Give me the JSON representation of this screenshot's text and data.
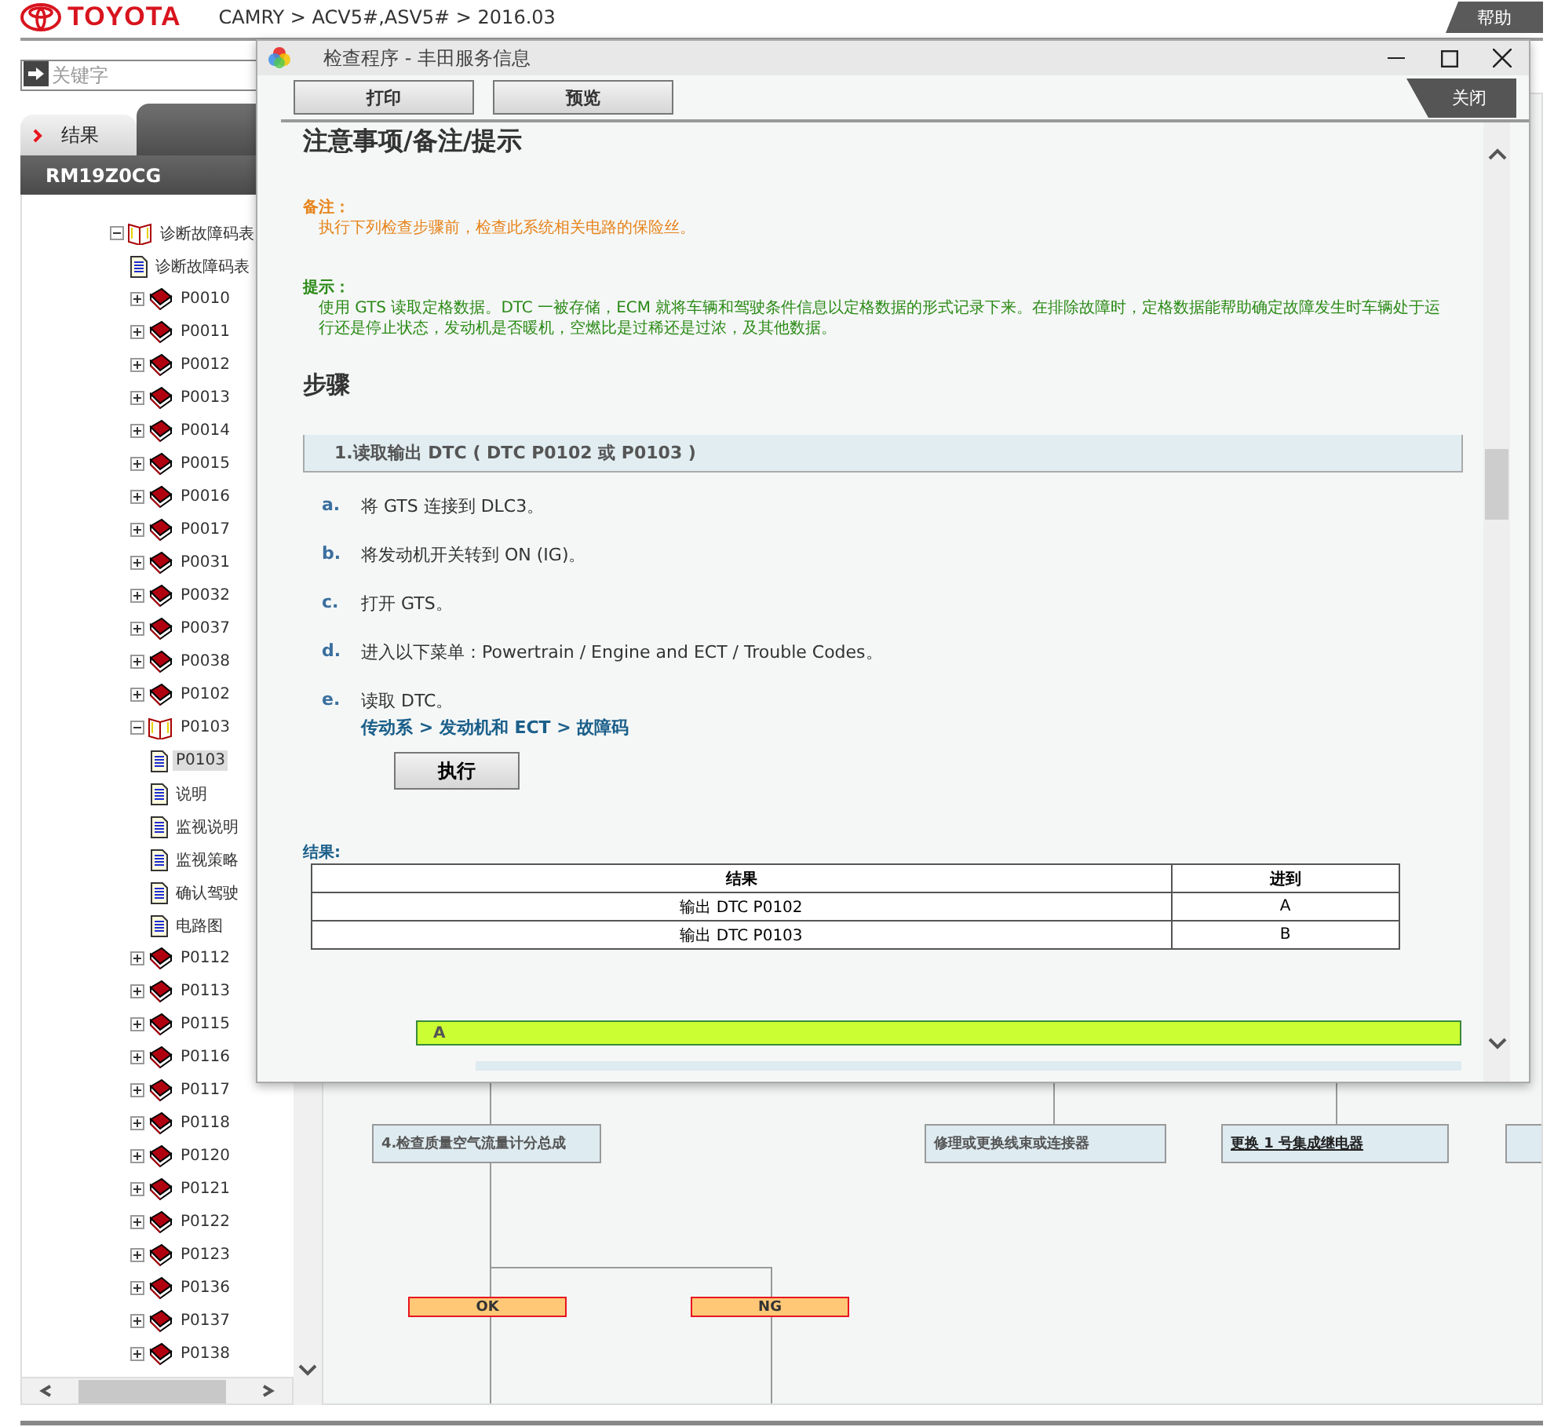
{
  "header": {
    "brand": "TOYOTA",
    "breadcrumb": "CAMRY > ACV5#,ASV5# > 2016.03",
    "help": "帮助"
  },
  "search": {
    "placeholder": "关键字"
  },
  "tabs": [
    {
      "label": "结果",
      "selected": true
    },
    {
      "selected": false
    }
  ],
  "panel_title": "RM19Z0CG",
  "tree": [
    {
      "label": "诊断故障码表",
      "kind": "chapter",
      "expanded": true,
      "selected": false,
      "children": [
        {
          "label": "诊断故障码表",
          "kind": "page",
          "selected": false
        },
        {
          "label": "P0010",
          "kind": "chapter",
          "expanded": false,
          "selected": false
        },
        {
          "label": "P0011",
          "kind": "chapter",
          "expanded": false,
          "selected": false
        },
        {
          "label": "P0012",
          "kind": "chapter",
          "expanded": false,
          "selected": false
        },
        {
          "label": "P0013",
          "kind": "chapter",
          "expanded": false,
          "selected": false
        },
        {
          "label": "P0014",
          "kind": "chapter",
          "expanded": false,
          "selected": false
        },
        {
          "label": "P0015",
          "kind": "chapter",
          "expanded": false,
          "selected": false
        },
        {
          "label": "P0016",
          "kind": "chapter",
          "expanded": false,
          "selected": false
        },
        {
          "label": "P0017",
          "kind": "chapter",
          "expanded": false,
          "selected": false
        },
        {
          "label": "P0031",
          "kind": "chapter",
          "expanded": false,
          "selected": false
        },
        {
          "label": "P0032",
          "kind": "chapter",
          "expanded": false,
          "selected": false
        },
        {
          "label": "P0037",
          "kind": "chapter",
          "expanded": false,
          "selected": false
        },
        {
          "label": "P0038",
          "kind": "chapter",
          "expanded": false,
          "selected": false
        },
        {
          "label": "P0102",
          "kind": "chapter",
          "expanded": false,
          "selected": false
        },
        {
          "label": "P0103",
          "kind": "chapter",
          "expanded": true,
          "selected": false,
          "children": [
            {
              "label": "P0103",
              "kind": "page",
              "selected": true
            },
            {
              "label": "说明",
              "kind": "page",
              "selected": false
            },
            {
              "label": "监视说明",
              "kind": "page",
              "selected": false
            },
            {
              "label": "监视策略",
              "kind": "page",
              "selected": false
            },
            {
              "label": "确认驾驶",
              "kind": "page",
              "selected": false
            },
            {
              "label": "电路图",
              "kind": "page",
              "selected": false
            }
          ]
        },
        {
          "label": "P0112",
          "kind": "chapter",
          "expanded": false,
          "selected": false
        },
        {
          "label": "P0113",
          "kind": "chapter",
          "expanded": false,
          "selected": false
        },
        {
          "label": "P0115",
          "kind": "chapter",
          "expanded": false,
          "selected": false
        },
        {
          "label": "P0116",
          "kind": "chapter",
          "expanded": false,
          "selected": false
        },
        {
          "label": "P0117",
          "kind": "chapter",
          "expanded": false,
          "selected": false
        },
        {
          "label": "P0118",
          "kind": "chapter",
          "expanded": false,
          "selected": false
        },
        {
          "label": "P0120",
          "kind": "chapter",
          "expanded": false,
          "selected": false
        },
        {
          "label": "P0121",
          "kind": "chapter",
          "expanded": false,
          "selected": false
        },
        {
          "label": "P0122",
          "kind": "chapter",
          "expanded": false,
          "selected": false
        },
        {
          "label": "P0123",
          "kind": "chapter",
          "expanded": false,
          "selected": false
        },
        {
          "label": "P0136",
          "kind": "chapter",
          "expanded": false,
          "selected": false
        },
        {
          "label": "P0137",
          "kind": "chapter",
          "expanded": false,
          "selected": false
        },
        {
          "label": "P0138",
          "kind": "chapter",
          "expanded": false,
          "selected": false
        }
      ]
    }
  ],
  "flowchart": {
    "boxes": [
      {
        "text": "4.检查质量空气流量计分总成",
        "kind": "step"
      },
      {
        "text": "修理或更换线束或连接器",
        "kind": "step"
      },
      {
        "text": "更换 1 号集成继电器",
        "kind": "link"
      },
      {
        "kind": "cut"
      }
    ],
    "outcomes": [
      {
        "label": "OK"
      },
      {
        "label": "NG"
      }
    ]
  },
  "dialog": {
    "title": "检查程序 - 丰田服务信息",
    "buttons": [
      "打印",
      "预览"
    ],
    "close": "关闭",
    "heading": "注意事项/备注/提示",
    "notes": [
      {
        "kind": "caution",
        "label": "备注：",
        "text": "执行下列检查步骤前，检查此系统相关电路的保险丝。"
      },
      {
        "kind": "hint",
        "label": "提示：",
        "text": "使用 GTS 读取定格数据。DTC 一被存储，ECM 就将车辆和驾驶条件信息以定格数据的形式记录下来。在排除故障时，定格数据能帮助确定故障发生时车辆处于运行还是停止状态，发动机是否暖机，空燃比是过稀还是过浓，及其他数据。"
      }
    ],
    "steps_heading": "步骤",
    "step": {
      "title": "1.读取输出 DTC ( DTC P0102 或 P0103 )",
      "items": [
        {
          "marker": "a.",
          "text": "将 GTS 连接到 DLC3。"
        },
        {
          "marker": "b.",
          "text": "将发动机开关转到 ON (IG)。"
        },
        {
          "marker": "c.",
          "text": "打开 GTS。"
        },
        {
          "marker": "d.",
          "text": "进入以下菜单：Powertrain / Engine and ECT / Trouble Codes。"
        },
        {
          "marker": "e.",
          "text": "读取 DTC。",
          "path": "传动系 > 发动机和 ECT > 故障码"
        }
      ],
      "button": "执行"
    },
    "result": {
      "label": "结果:",
      "columns": [
        "结果",
        "进到"
      ],
      "rows": [
        [
          "输出 DTC P0102",
          "A"
        ],
        [
          "输出 DTC P0103",
          "B"
        ]
      ]
    },
    "branch": "A"
  }
}
